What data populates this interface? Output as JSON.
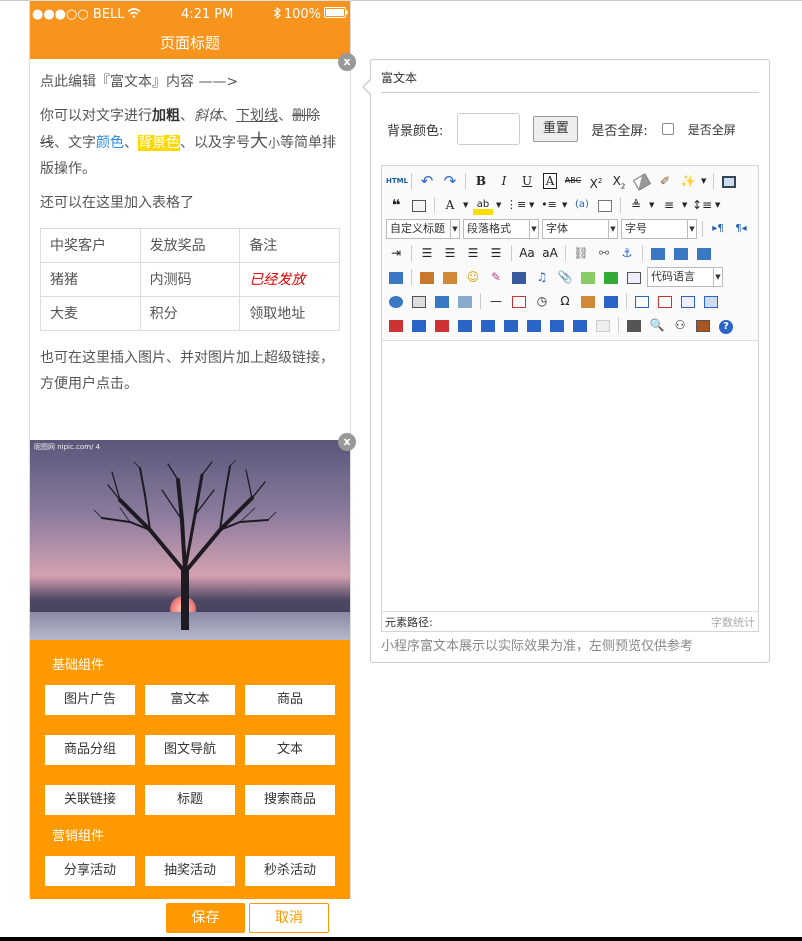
{
  "status_bar": {
    "carrier": "●●●○○ BELL",
    "time": "4:21 PM",
    "battery": "100%",
    "icons": [
      "wifi-icon",
      "bluetooth-icon",
      "battery-icon"
    ]
  },
  "phone": {
    "title": "页面标题",
    "rich_text": {
      "line1": "点此编辑『富文本』内容 ——>",
      "p2_a": "你可以对文字进行",
      "bold": "加粗",
      "sep1": "、",
      "italic": "斜体",
      "sep2": "、",
      "underline": "下划线",
      "sep3": "、",
      "strike": "删除线",
      "p2_b": "、文字",
      "color": "颜色",
      "sep4": "、",
      "bgcolor": "背景色",
      "p2_c": "、以及字号",
      "big": "大",
      "small": "小",
      "p2_d": "等简单排版操作。",
      "p3": "还可以在这里加入表格了",
      "table": [
        [
          "中奖客户",
          "发放奖品",
          "备注"
        ],
        [
          "猪猪",
          "内测码",
          "已经发放"
        ],
        [
          "大麦",
          "积分",
          "领取地址"
        ]
      ],
      "p4": "也可在这里插入图片、并对图片加上超级链接，方便用户点击。"
    },
    "close_label": "x",
    "image_watermark": "昵图网 nipic.com/ 4",
    "basic_title": "基础组件",
    "basic_components": [
      "图片广告",
      "富文本",
      "商品",
      "商品分组",
      "图文导航",
      "文本",
      "关联链接",
      "标题",
      "搜索商品"
    ],
    "marketing_title": "营销组件",
    "marketing_components": [
      "分享活动",
      "抽奖活动",
      "秒杀活动"
    ]
  },
  "footer": {
    "save": "保存",
    "cancel": "取消"
  },
  "editor": {
    "title": "富文本",
    "bg_label": "背景颜色:",
    "reset": "重置",
    "fullscreen_label": "是否全屏:",
    "fullscreen_text": "是否全屏",
    "fullscreen_checked": false,
    "toolbar": {
      "html": "HTML",
      "font_style_select": "自定义标题",
      "paragraph_select": "段落格式",
      "font_family_select": "字体",
      "font_size_select": "字号",
      "code_lang_select": "代码语言"
    },
    "element_path": "元素路径:",
    "word_count": "字数统计",
    "note": "小程序富文本展示以实际效果为准，左侧预览仅供参考"
  },
  "colors": {
    "brand": "#ff9900",
    "accent_blue": "#2e8ae6",
    "red": "#e60000"
  }
}
